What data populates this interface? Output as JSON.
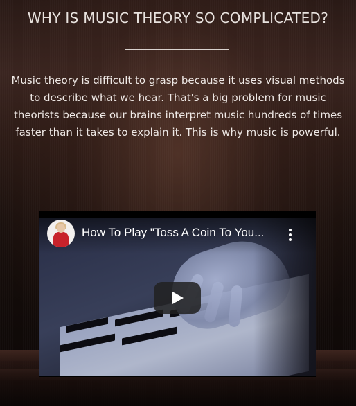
{
  "section": {
    "title": "WHY IS MUSIC THEORY SO COMPLICATED?",
    "description_lines": [
      "Music theory is difficult to grasp because it uses visual methods",
      "to describe what we hear. That's a big problem for music",
      "theorists because our brains interpret music hundreds of times",
      "faster than it takes to explain it. This is why music is powerful."
    ]
  },
  "video": {
    "title": "How To Play \"Toss A Coin To You...",
    "channel_avatar_icon": "channel-avatar-icon",
    "more_icon": "more-vertical-icon",
    "play_icon": "play-icon"
  },
  "colors": {
    "title_text": "#e8e2de",
    "body_text": "#efe9e6",
    "play_button_bg": "#212121",
    "avatar_shirt": "#c8232b"
  }
}
